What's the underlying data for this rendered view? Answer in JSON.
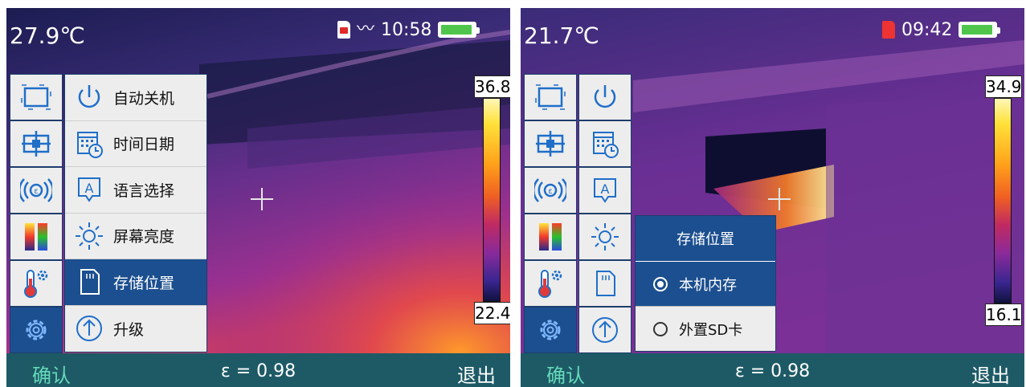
{
  "left": {
    "temperature": "27.9℃",
    "status": {
      "time": "10:58",
      "battery_level": 0.85
    },
    "scale": {
      "max": "36.8",
      "min": "22.4"
    },
    "sidebar_icons": [
      "frame-icon",
      "center-point-icon",
      "emissivity-icon",
      "palette-icon",
      "thermometer-settings-icon",
      "settings-gear-icon"
    ],
    "menu": [
      {
        "icon": "power-icon",
        "label": "自动关机"
      },
      {
        "icon": "calendar-clock-icon",
        "label": "时间日期"
      },
      {
        "icon": "language-icon",
        "label": "语言选择"
      },
      {
        "icon": "brightness-icon",
        "label": "屏幕亮度"
      },
      {
        "icon": "sd-card-icon",
        "label": "存储位置",
        "active": true
      },
      {
        "icon": "upgrade-icon",
        "label": "升级"
      }
    ],
    "bottom": {
      "confirm": "确认",
      "emissivity": "ε = 0.98",
      "exit": "退出"
    }
  },
  "right": {
    "temperature": "21.7℃",
    "status": {
      "time": "09:42",
      "battery_level": 0.85
    },
    "scale": {
      "max": "34.9",
      "min": "16.1"
    },
    "submenu": {
      "title": "存储位置",
      "options": [
        {
          "label": "本机内存",
          "selected": true
        },
        {
          "label": "外置SD卡",
          "selected": false
        }
      ]
    },
    "bottom": {
      "confirm": "确认",
      "emissivity": "ε = 0.98",
      "exit": "退出"
    }
  },
  "colors": {
    "menu_active": "#1c4f8f",
    "bottom_bar": "#1d5a66",
    "confirm_text": "#66d9b8"
  }
}
